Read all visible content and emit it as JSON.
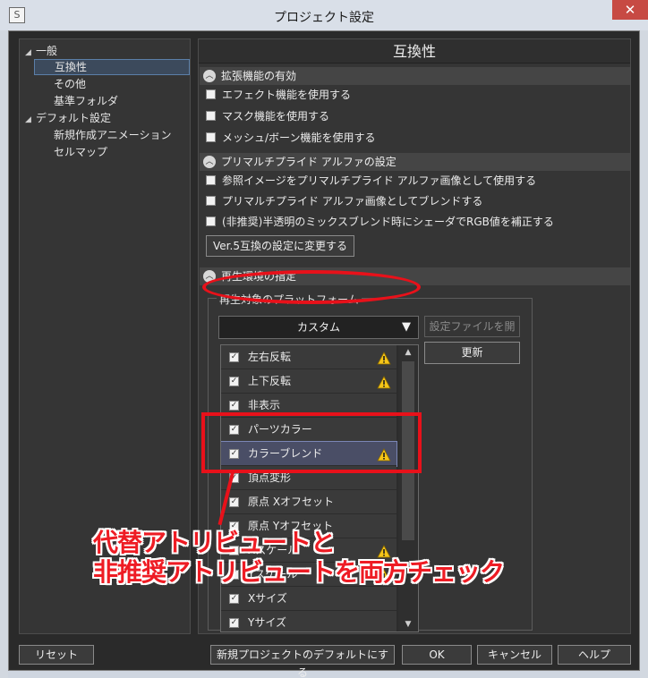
{
  "window": {
    "title": "プロジェクト設定",
    "app_icon": "S",
    "close_glyph": "✕"
  },
  "tree": {
    "items": [
      {
        "label": "一般",
        "expanded": true
      },
      {
        "label": "互換性",
        "selected": true
      },
      {
        "label": "その他"
      },
      {
        "label": "基準フォルダ"
      },
      {
        "label": "デフォルト設定",
        "expanded": true
      },
      {
        "label": "新規作成アニメーション"
      },
      {
        "label": "セルマップ"
      }
    ]
  },
  "panel": {
    "title": "互換性",
    "sections": [
      {
        "label": "拡張機能の有効",
        "icon": "chevron-up-icon",
        "checks": [
          {
            "label": "エフェクト機能を使用する",
            "checked": false
          },
          {
            "label": "マスク機能を使用する",
            "checked": false
          },
          {
            "label": "メッシュ/ボーン機能を使用する",
            "checked": false
          }
        ]
      },
      {
        "label": "プリマルチプライド アルファの設定",
        "icon": "chevron-up-icon",
        "checks": [
          {
            "label": "参照イメージをプリマルチプライド アルファ画像として使用する",
            "checked": false
          },
          {
            "label": "プリマルチプライド アルファ画像としてブレンドする",
            "checked": false
          },
          {
            "label": "(非推奨)半透明のミックスブレンド時にシェーダでRGB値を補正する",
            "checked": false
          }
        ],
        "button": "Ver.5互換の設定に変更する"
      },
      {
        "label": "再生環境の指定",
        "icon": "chevron-up-icon"
      }
    ],
    "platform": {
      "group_label": "再生対象のプラットフォーム",
      "selected": "カスタム",
      "open_file_button": "設定ファイルを開く",
      "refresh_button": "更新",
      "attributes": [
        {
          "label": "左右反転",
          "checked": true,
          "warning": true
        },
        {
          "label": "上下反転",
          "checked": true,
          "warning": true
        },
        {
          "label": "非表示",
          "checked": true,
          "warning": false
        },
        {
          "label": "パーツカラー",
          "checked": true,
          "warning": false
        },
        {
          "label": "カラーブレンド",
          "checked": true,
          "warning": true,
          "selected": true
        },
        {
          "label": "頂点変形",
          "checked": true,
          "warning": false
        },
        {
          "label": "原点 Xオフセット",
          "checked": true,
          "warning": false
        },
        {
          "label": "原点 Yオフセット",
          "checked": true,
          "warning": false
        },
        {
          "label": "Xスケール",
          "checked": true,
          "warning": true
        },
        {
          "label": "Yスケール",
          "checked": true,
          "warning": true
        },
        {
          "label": "Xサイズ",
          "checked": true,
          "warning": false
        },
        {
          "label": "Yサイズ",
          "checked": true,
          "warning": false
        }
      ]
    }
  },
  "footer": {
    "reset": "リセット",
    "set_default": "新規プロジェクトのデフォルトにする",
    "ok": "OK",
    "cancel": "キャンセル",
    "help": "ヘルプ"
  },
  "annotation": {
    "line1": "代替アトリビュートと",
    "line2": "非推奨アトリビュートを両方チェック",
    "color": "#ee1c24"
  }
}
